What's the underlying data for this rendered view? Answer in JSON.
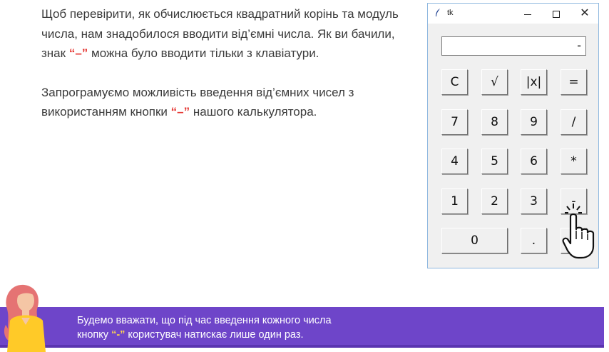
{
  "lesson": {
    "p1_part1": "Щоб перевірити, як обчислюється квадратний корінь та модуль числа, нам знадобилося вводити від’ємні числа. Як ви бачили, знак ",
    "p1_minus": "“–”",
    "p1_part2": " можна було вводити тільки з клавіатури.",
    "p2_part1": "Запрограмуємо можливість введення від’ємних чисел з використанням кнопки ",
    "p2_minus": "“–”",
    "p2_part2": " нашого калькулятора."
  },
  "window": {
    "title": "tk",
    "minimize": "–",
    "close": "✕",
    "display_value": "-"
  },
  "keys": [
    {
      "label": "C",
      "name": "key-clear"
    },
    {
      "label": "√",
      "name": "key-sqrt"
    },
    {
      "label": "|x|",
      "name": "key-abs"
    },
    {
      "label": "=",
      "name": "key-equals"
    },
    {
      "label": "7",
      "name": "key-7"
    },
    {
      "label": "8",
      "name": "key-8"
    },
    {
      "label": "9",
      "name": "key-9"
    },
    {
      "label": "/",
      "name": "key-divide"
    },
    {
      "label": "4",
      "name": "key-4"
    },
    {
      "label": "5",
      "name": "key-5"
    },
    {
      "label": "6",
      "name": "key-6"
    },
    {
      "label": "*",
      "name": "key-multiply"
    },
    {
      "label": "1",
      "name": "key-1"
    },
    {
      "label": "2",
      "name": "key-2"
    },
    {
      "label": "3",
      "name": "key-3"
    },
    {
      "label": "-",
      "name": "key-minus"
    },
    {
      "label": "0",
      "name": "key-0"
    },
    {
      "label": ".",
      "name": "key-dot"
    },
    {
      "label": "",
      "name": "key-plus-hidden"
    }
  ],
  "banner": {
    "line1": "Будемо вважати, що під час введення кожного числа",
    "line2_part1": "кнопку ",
    "line2_minus": "“-”",
    "line2_part2": " користувач натискає лише один раз."
  },
  "colors": {
    "highlight": "#e53935",
    "banner_bg": "#6e45c9",
    "banner_highlight": "#ffd54f"
  }
}
